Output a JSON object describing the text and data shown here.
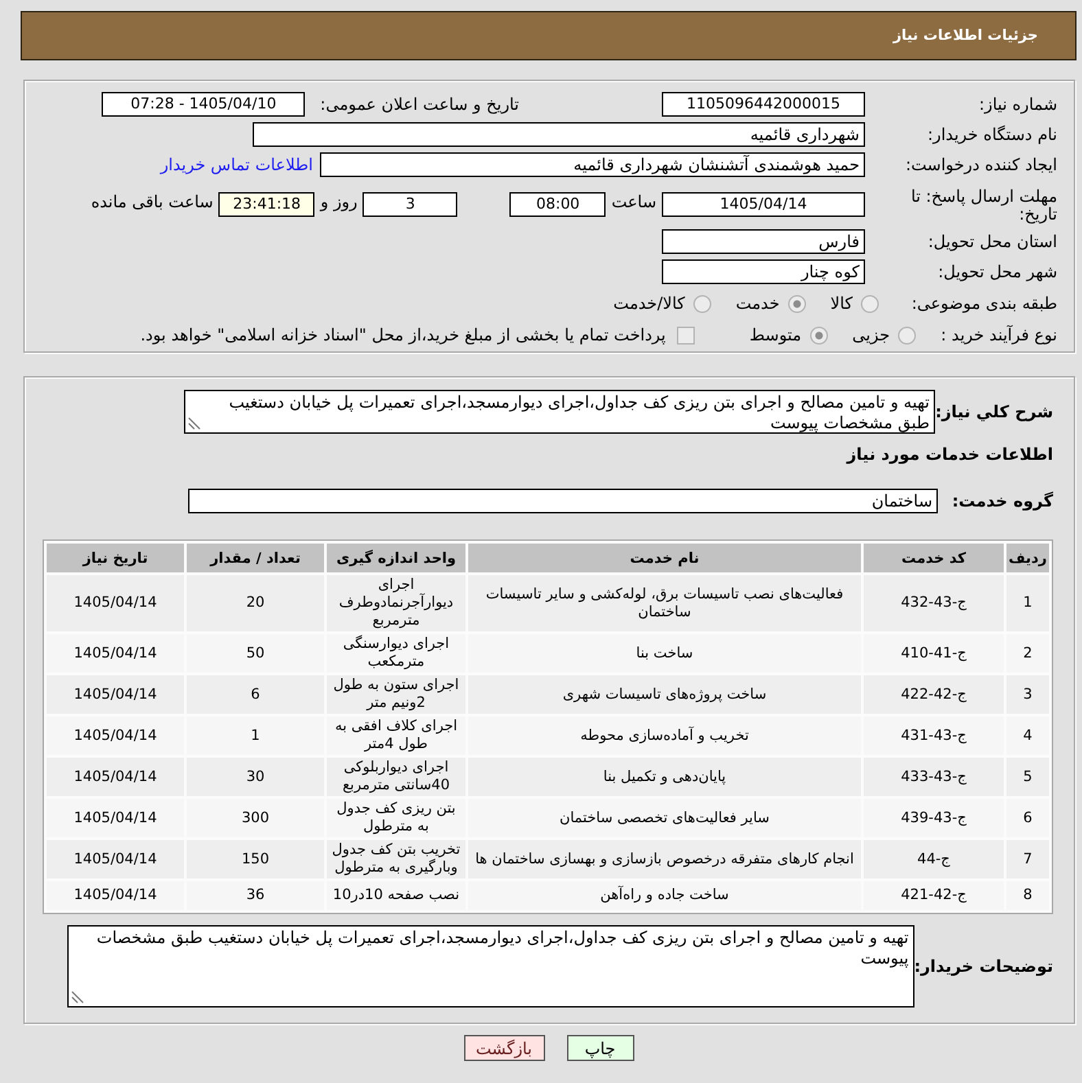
{
  "header": {
    "title": "جزئیات اطلاعات نیاز"
  },
  "details": {
    "need_number": {
      "label": "شماره نیاز:",
      "value": "1105096442000015"
    },
    "announce_date": {
      "label": "تاریخ و ساعت اعلان عمومی:",
      "value": "1405/04/10 - 07:28"
    },
    "buyer_org": {
      "label": "نام دستگاه خریدار:",
      "value": "شهرداری قائمیه"
    },
    "requester": {
      "label": "ایجاد کننده درخواست:",
      "value": "حمید هوشمندی آتشنشان شهرداری قائمیه",
      "contact_link": "اطلاعات تماس خریدار"
    },
    "deadline": {
      "label": "مهلت ارسال پاسخ: تا تاریخ:",
      "date": "1405/04/14",
      "time_label": "ساعت",
      "time": "08:00",
      "days": "3",
      "days_label": "روز و",
      "remaining": "23:41:18",
      "remaining_label": "ساعت باقی مانده"
    },
    "province": {
      "label": "استان محل تحویل:",
      "value": "فارس"
    },
    "city": {
      "label": "شهر محل تحویل:",
      "value": "کوه چنار"
    },
    "category": {
      "label": "طبقه بندی موضوعی:",
      "options": [
        {
          "label": "کالا",
          "selected": false
        },
        {
          "label": "خدمت",
          "selected": true
        },
        {
          "label": "کالا/خدمت",
          "selected": false
        }
      ]
    },
    "purchase_type": {
      "label": "نوع فرآیند خرید :",
      "options": [
        {
          "label": "جزیی",
          "selected": false
        },
        {
          "label": "متوسط",
          "selected": true
        }
      ],
      "treasury_option": {
        "label": "پرداخت تمام یا بخشی از مبلغ خرید،از محل \"اسناد خزانه اسلامی\" خواهد بود.",
        "checked": false
      }
    }
  },
  "need": {
    "description": {
      "label": "شرح کلي نیاز:",
      "value": "تهیه و تامین مصالح و اجرای بتن ریزی کف جداول،اجرای دیوارمسجد،اجرای تعمیرات پل خیابان دستغیب طبق مشخصات پیوست"
    },
    "services_title": "اطلاعات خدمات مورد نیاز",
    "service_group": {
      "label": "گروه خدمت:",
      "value": "ساختمان"
    },
    "table": {
      "columns": [
        "ردیف",
        "کد خدمت",
        "نام خدمت",
        "واحد اندازه گیری",
        "تعداد / مقدار",
        "تاریخ نیاز"
      ],
      "rows": [
        {
          "row_number": "1",
          "code": "ج-43-432",
          "name": "فعالیت‌های نصب تاسیسات برق، لوله‌کشی و سایر تاسیسات ساختمان",
          "unit": "اجرای دیوارآجرنمادوطرف مترمربع",
          "quantity": "20",
          "date": "1405/04/14"
        },
        {
          "row_number": "2",
          "code": "ج-41-410",
          "name": "ساخت بنا",
          "unit": "اجرای دیوارسنگی مترمکعب",
          "quantity": "50",
          "date": "1405/04/14"
        },
        {
          "row_number": "3",
          "code": "ج-42-422",
          "name": "ساخت پروژه‌های تاسیسات شهری",
          "unit": "اجرای ستون به طول 2ونیم متر",
          "quantity": "6",
          "date": "1405/04/14"
        },
        {
          "row_number": "4",
          "code": "ج-43-431",
          "name": "تخریب و آماده‌سازی محوطه",
          "unit": "اجرای کلاف افقی به طول 4متر",
          "quantity": "1",
          "date": "1405/04/14"
        },
        {
          "row_number": "5",
          "code": "ج-43-433",
          "name": "پایان‌دهی و تکمیل بنا",
          "unit": "اجرای دیواربلوکی 40سانتی مترمربع",
          "quantity": "30",
          "date": "1405/04/14"
        },
        {
          "row_number": "6",
          "code": "ج-43-439",
          "name": "سایر فعالیت‌های تخصصی ساختمان",
          "unit": "بتن ریزی کف جدول به مترطول",
          "quantity": "300",
          "date": "1405/04/14"
        },
        {
          "row_number": "7",
          "code": "ج-44",
          "name": "انجام کارهای متفرقه درخصوص بازسازی و بهسازی ساختمان ها",
          "unit": "تخریب بتن کف جدول وبارگیری به مترطول",
          "quantity": "150",
          "date": "1405/04/14"
        },
        {
          "row_number": "8",
          "code": "ج-42-421",
          "name": "ساخت جاده و راه‌آهن",
          "unit": "نصب صفحه 10در10",
          "quantity": "36",
          "date": "1405/04/14"
        }
      ]
    },
    "buyer_notes": {
      "label": "توضیحات خریدار:",
      "value": "تهیه و تامین مصالح و اجرای بتن ریزی کف جداول،اجرای دیوارمسجد،اجرای تعمیرات پل خیابان دستغیب طبق مشخصات پیوست"
    }
  },
  "buttons": [
    {
      "label": "چاپ",
      "kind": "print"
    },
    {
      "label": "بازگشت",
      "kind": "back"
    }
  ]
}
